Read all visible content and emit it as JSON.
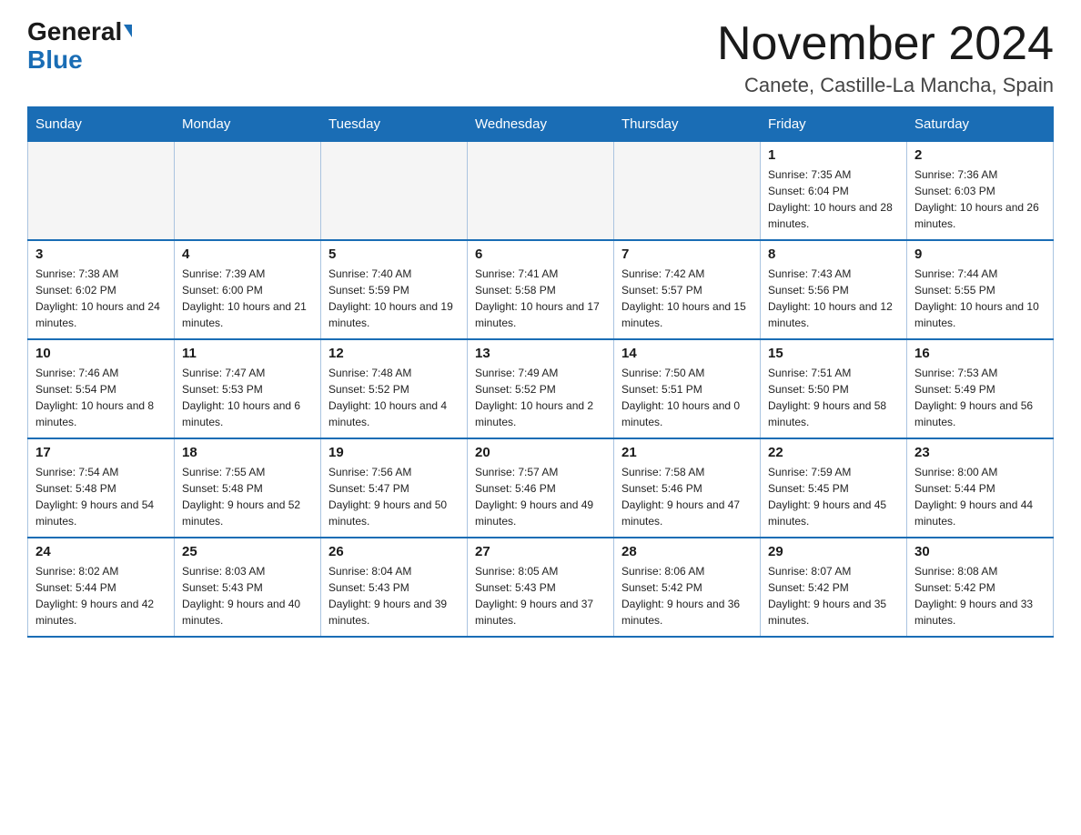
{
  "header": {
    "logo_general": "General",
    "logo_blue": "Blue",
    "month_title": "November 2024",
    "location": "Canete, Castille-La Mancha, Spain"
  },
  "days_of_week": [
    "Sunday",
    "Monday",
    "Tuesday",
    "Wednesday",
    "Thursday",
    "Friday",
    "Saturday"
  ],
  "weeks": [
    [
      {
        "day": "",
        "info": ""
      },
      {
        "day": "",
        "info": ""
      },
      {
        "day": "",
        "info": ""
      },
      {
        "day": "",
        "info": ""
      },
      {
        "day": "",
        "info": ""
      },
      {
        "day": "1",
        "info": "Sunrise: 7:35 AM\nSunset: 6:04 PM\nDaylight: 10 hours and 28 minutes."
      },
      {
        "day": "2",
        "info": "Sunrise: 7:36 AM\nSunset: 6:03 PM\nDaylight: 10 hours and 26 minutes."
      }
    ],
    [
      {
        "day": "3",
        "info": "Sunrise: 7:38 AM\nSunset: 6:02 PM\nDaylight: 10 hours and 24 minutes."
      },
      {
        "day": "4",
        "info": "Sunrise: 7:39 AM\nSunset: 6:00 PM\nDaylight: 10 hours and 21 minutes."
      },
      {
        "day": "5",
        "info": "Sunrise: 7:40 AM\nSunset: 5:59 PM\nDaylight: 10 hours and 19 minutes."
      },
      {
        "day": "6",
        "info": "Sunrise: 7:41 AM\nSunset: 5:58 PM\nDaylight: 10 hours and 17 minutes."
      },
      {
        "day": "7",
        "info": "Sunrise: 7:42 AM\nSunset: 5:57 PM\nDaylight: 10 hours and 15 minutes."
      },
      {
        "day": "8",
        "info": "Sunrise: 7:43 AM\nSunset: 5:56 PM\nDaylight: 10 hours and 12 minutes."
      },
      {
        "day": "9",
        "info": "Sunrise: 7:44 AM\nSunset: 5:55 PM\nDaylight: 10 hours and 10 minutes."
      }
    ],
    [
      {
        "day": "10",
        "info": "Sunrise: 7:46 AM\nSunset: 5:54 PM\nDaylight: 10 hours and 8 minutes."
      },
      {
        "day": "11",
        "info": "Sunrise: 7:47 AM\nSunset: 5:53 PM\nDaylight: 10 hours and 6 minutes."
      },
      {
        "day": "12",
        "info": "Sunrise: 7:48 AM\nSunset: 5:52 PM\nDaylight: 10 hours and 4 minutes."
      },
      {
        "day": "13",
        "info": "Sunrise: 7:49 AM\nSunset: 5:52 PM\nDaylight: 10 hours and 2 minutes."
      },
      {
        "day": "14",
        "info": "Sunrise: 7:50 AM\nSunset: 5:51 PM\nDaylight: 10 hours and 0 minutes."
      },
      {
        "day": "15",
        "info": "Sunrise: 7:51 AM\nSunset: 5:50 PM\nDaylight: 9 hours and 58 minutes."
      },
      {
        "day": "16",
        "info": "Sunrise: 7:53 AM\nSunset: 5:49 PM\nDaylight: 9 hours and 56 minutes."
      }
    ],
    [
      {
        "day": "17",
        "info": "Sunrise: 7:54 AM\nSunset: 5:48 PM\nDaylight: 9 hours and 54 minutes."
      },
      {
        "day": "18",
        "info": "Sunrise: 7:55 AM\nSunset: 5:48 PM\nDaylight: 9 hours and 52 minutes."
      },
      {
        "day": "19",
        "info": "Sunrise: 7:56 AM\nSunset: 5:47 PM\nDaylight: 9 hours and 50 minutes."
      },
      {
        "day": "20",
        "info": "Sunrise: 7:57 AM\nSunset: 5:46 PM\nDaylight: 9 hours and 49 minutes."
      },
      {
        "day": "21",
        "info": "Sunrise: 7:58 AM\nSunset: 5:46 PM\nDaylight: 9 hours and 47 minutes."
      },
      {
        "day": "22",
        "info": "Sunrise: 7:59 AM\nSunset: 5:45 PM\nDaylight: 9 hours and 45 minutes."
      },
      {
        "day": "23",
        "info": "Sunrise: 8:00 AM\nSunset: 5:44 PM\nDaylight: 9 hours and 44 minutes."
      }
    ],
    [
      {
        "day": "24",
        "info": "Sunrise: 8:02 AM\nSunset: 5:44 PM\nDaylight: 9 hours and 42 minutes."
      },
      {
        "day": "25",
        "info": "Sunrise: 8:03 AM\nSunset: 5:43 PM\nDaylight: 9 hours and 40 minutes."
      },
      {
        "day": "26",
        "info": "Sunrise: 8:04 AM\nSunset: 5:43 PM\nDaylight: 9 hours and 39 minutes."
      },
      {
        "day": "27",
        "info": "Sunrise: 8:05 AM\nSunset: 5:43 PM\nDaylight: 9 hours and 37 minutes."
      },
      {
        "day": "28",
        "info": "Sunrise: 8:06 AM\nSunset: 5:42 PM\nDaylight: 9 hours and 36 minutes."
      },
      {
        "day": "29",
        "info": "Sunrise: 8:07 AM\nSunset: 5:42 PM\nDaylight: 9 hours and 35 minutes."
      },
      {
        "day": "30",
        "info": "Sunrise: 8:08 AM\nSunset: 5:42 PM\nDaylight: 9 hours and 33 minutes."
      }
    ]
  ]
}
